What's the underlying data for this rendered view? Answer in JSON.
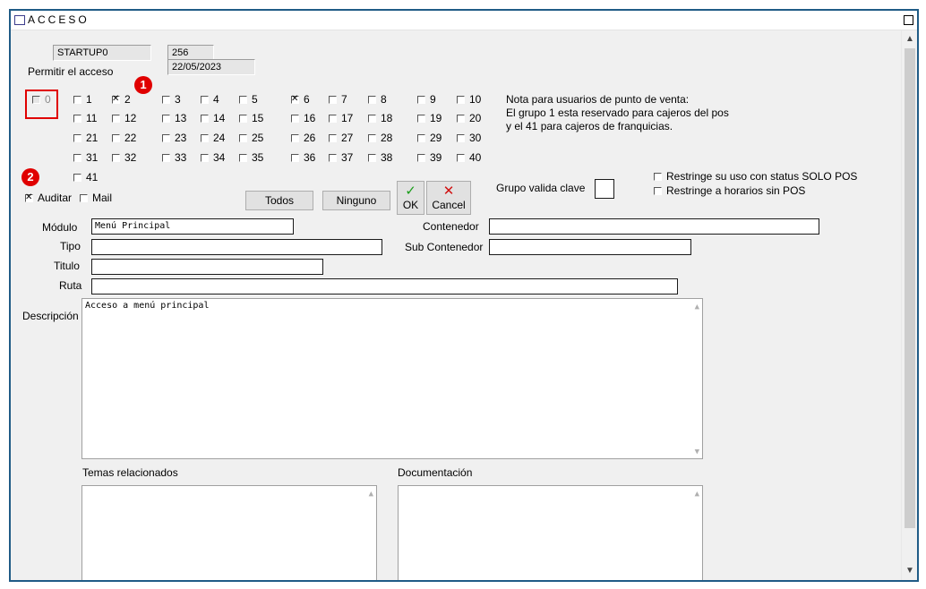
{
  "window": {
    "title": "ACCESO",
    "startup_value": "STARTUP0",
    "id_value": "256",
    "date_value": "22/05/2023"
  },
  "access": {
    "label": "Permitir el acceso",
    "groups": [
      {
        "num": "0",
        "checked": false,
        "disabled": true
      },
      {
        "num": "1",
        "checked": false
      },
      {
        "num": "2",
        "checked": true
      },
      {
        "num": "3",
        "checked": false
      },
      {
        "num": "4",
        "checked": false
      },
      {
        "num": "5",
        "checked": false
      },
      {
        "num": "6",
        "checked": true
      },
      {
        "num": "7",
        "checked": false
      },
      {
        "num": "8",
        "checked": false
      },
      {
        "num": "9",
        "checked": false
      },
      {
        "num": "10",
        "checked": false
      },
      {
        "num": "11",
        "checked": false
      },
      {
        "num": "12",
        "checked": false
      },
      {
        "num": "13",
        "checked": false
      },
      {
        "num": "14",
        "checked": false
      },
      {
        "num": "15",
        "checked": false
      },
      {
        "num": "16",
        "checked": false
      },
      {
        "num": "17",
        "checked": false
      },
      {
        "num": "18",
        "checked": false
      },
      {
        "num": "19",
        "checked": false
      },
      {
        "num": "20",
        "checked": false
      },
      {
        "num": "21",
        "checked": false
      },
      {
        "num": "22",
        "checked": false
      },
      {
        "num": "23",
        "checked": false
      },
      {
        "num": "24",
        "checked": false
      },
      {
        "num": "25",
        "checked": false
      },
      {
        "num": "26",
        "checked": false
      },
      {
        "num": "27",
        "checked": false
      },
      {
        "num": "28",
        "checked": false
      },
      {
        "num": "29",
        "checked": false
      },
      {
        "num": "30",
        "checked": false
      },
      {
        "num": "31",
        "checked": false
      },
      {
        "num": "32",
        "checked": false
      },
      {
        "num": "33",
        "checked": false
      },
      {
        "num": "34",
        "checked": false
      },
      {
        "num": "35",
        "checked": false
      },
      {
        "num": "36",
        "checked": false
      },
      {
        "num": "37",
        "checked": false
      },
      {
        "num": "38",
        "checked": false
      },
      {
        "num": "39",
        "checked": false
      },
      {
        "num": "40",
        "checked": false
      },
      {
        "num": "41",
        "checked": false
      }
    ],
    "note": [
      "Nota para usuarios de punto de venta:",
      "El grupo 1 esta reservado para cajeros del pos",
      "y el 41 para cajeros de franquicias."
    ]
  },
  "badges": {
    "one": "1",
    "two": "2"
  },
  "options": {
    "auditar_label": "Auditar",
    "auditar_checked": true,
    "mail_label": "Mail",
    "mail_checked": false
  },
  "buttons": {
    "todos": "Todos",
    "ninguno": "Ninguno",
    "ok": "OK",
    "cancel": "Cancel",
    "ok_symbol": "✓",
    "cancel_symbol": "✕"
  },
  "grupo_valida_clave_label": "Grupo valida clave",
  "restrictions": {
    "solo_pos": "Restringe su uso con status  SOLO POS",
    "horarios": "Restringe a horarios sin POS"
  },
  "fields": {
    "modulo_label": "Módulo",
    "modulo_value": "Menú Principal",
    "tipo_label": "Tipo",
    "tipo_value": "",
    "titulo_label": "Titulo",
    "titulo_value": "",
    "ruta_label": "Ruta",
    "ruta_value": "",
    "contenedor_label": "Contenedor",
    "contenedor_value": "",
    "sub_contenedor_label": "Sub Contenedor",
    "sub_contenedor_value": "",
    "descripcion_label": "Descripción",
    "descripcion_value": "Acceso a menú principal",
    "temas_label": "Temas relacionados",
    "documentacion_label": "Documentación"
  },
  "colors": {
    "frame": "#1f5b86",
    "badge": "#e00000",
    "ok_green": "#1a9e1a",
    "cancel_red": "#d01010"
  }
}
